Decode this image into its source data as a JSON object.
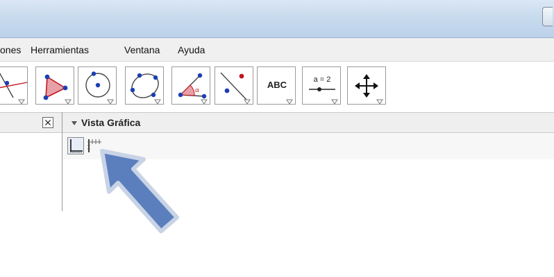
{
  "menu": {
    "items": [
      "ones",
      "Herramientas",
      "Ventana",
      "Ayuda"
    ]
  },
  "toolbar": {
    "tools": [
      {
        "name": "perpendicular-line-tool"
      },
      {
        "name": "polygon-tool"
      },
      {
        "name": "circle-center-point-tool"
      },
      {
        "name": "conic-five-points-tool"
      },
      {
        "name": "angle-tool"
      },
      {
        "name": "reflect-tool"
      },
      {
        "name": "text-tool",
        "label": "ABC"
      },
      {
        "name": "slider-tool",
        "label": "a = 2"
      },
      {
        "name": "move-graphics-view-tool"
      }
    ]
  },
  "view": {
    "title": "Vista Gráfica"
  },
  "colors": {
    "arrow": "#5b7fbd",
    "arrow_outline": "#c9d3e6",
    "point_blue": "#1a3fb3",
    "point_red": "#c0141c",
    "polygon_fill": "#e8a0a8"
  }
}
